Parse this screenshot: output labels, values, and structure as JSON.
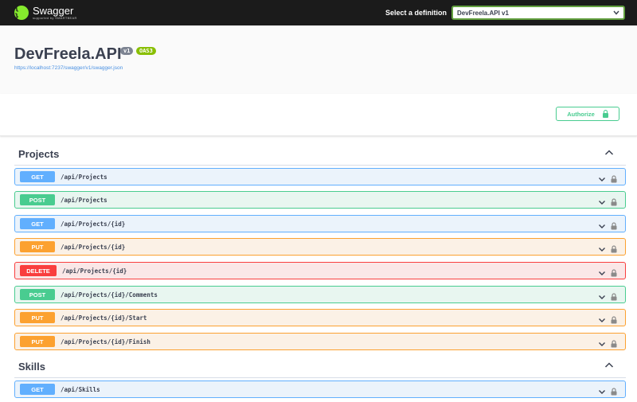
{
  "topbar": {
    "logo_title": "Swagger",
    "logo_sub": "supported by SMARTBEAR",
    "logo_glyph": "{ }",
    "definition_label": "Select a definition",
    "definition_value": "DevFreela.API v1"
  },
  "info": {
    "title": "DevFreela.API",
    "version_badge": "v1",
    "oas_badge": "OAS3",
    "url": "https://localhost:7237/swagger/v1/swagger.json"
  },
  "scheme": {
    "authorize_label": "Authorize"
  },
  "tags": [
    {
      "name": "Projects",
      "operations": [
        {
          "method": "GET",
          "path": "/api/Projects"
        },
        {
          "method": "POST",
          "path": "/api/Projects"
        },
        {
          "method": "GET",
          "path": "/api/Projects/{id}"
        },
        {
          "method": "PUT",
          "path": "/api/Projects/{id}"
        },
        {
          "method": "DELETE",
          "path": "/api/Projects/{id}"
        },
        {
          "method": "POST",
          "path": "/api/Projects/{id}/Comments"
        },
        {
          "method": "PUT",
          "path": "/api/Projects/{id}/Start"
        },
        {
          "method": "PUT",
          "path": "/api/Projects/{id}/Finish"
        }
      ]
    },
    {
      "name": "Skills",
      "operations": [
        {
          "method": "GET",
          "path": "/api/Skills"
        }
      ]
    }
  ],
  "colors": {
    "get": "#61affe",
    "post": "#49cc90",
    "put": "#fca130",
    "delete": "#f93e3e",
    "topbar": "#1b1b1b",
    "logo": "#85ea2d"
  },
  "icons": {
    "logo": "swagger-logo-icon",
    "definition_dropdown": "chevron-down-icon",
    "authorize": "lock-icon",
    "tag_toggle": "chevron-up-icon",
    "operation_expand": "chevron-down-icon",
    "operation_lock": "lock-icon"
  }
}
